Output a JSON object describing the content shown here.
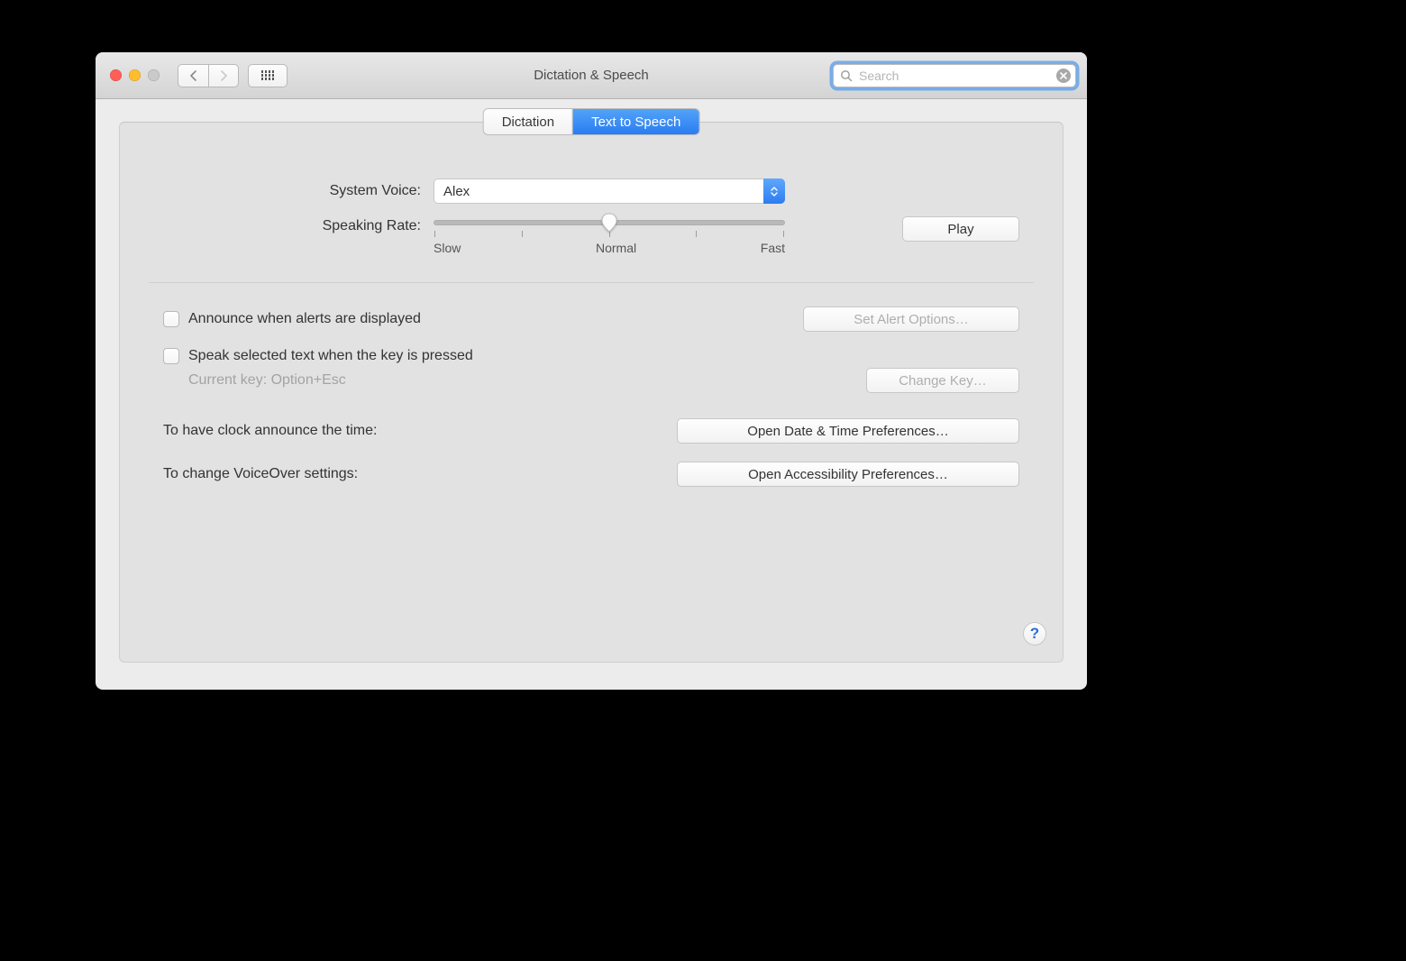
{
  "window": {
    "title": "Dictation & Speech"
  },
  "search": {
    "placeholder": "Search"
  },
  "tabs": {
    "dictation": "Dictation",
    "tts": "Text to Speech"
  },
  "voice": {
    "label": "System Voice:",
    "value": "Alex"
  },
  "rate": {
    "label": "Speaking Rate:",
    "slow": "Slow",
    "normal": "Normal",
    "fast": "Fast"
  },
  "play": "Play",
  "announce_alerts": {
    "label": "Announce when alerts are displayed",
    "button": "Set Alert Options…"
  },
  "speak_selected": {
    "label": "Speak selected text when the key is pressed",
    "current_key": "Current key: Option+Esc",
    "button": "Change Key…"
  },
  "clock": {
    "label": "To have clock announce the time:",
    "button": "Open Date & Time Preferences…"
  },
  "voiceover": {
    "label": "To change VoiceOver settings:",
    "button": "Open Accessibility Preferences…"
  },
  "help": "?"
}
